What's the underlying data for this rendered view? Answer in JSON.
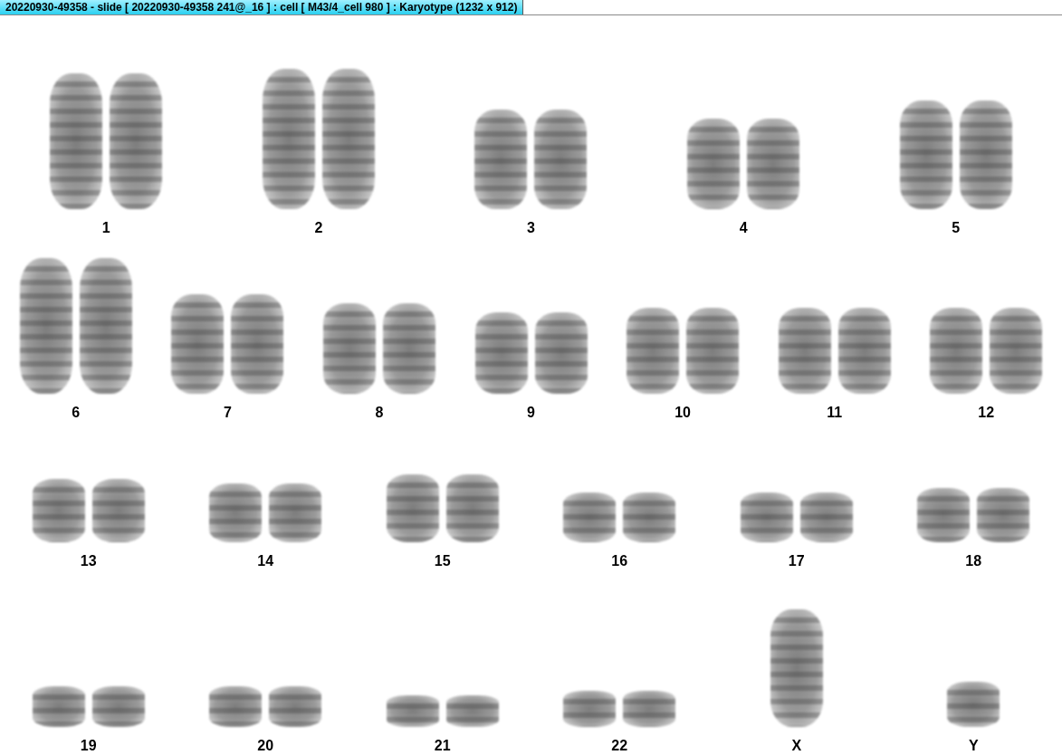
{
  "window": {
    "title": "20220930-49358 - slide [ 20220930-49358 241@_16 ] : cell [ M43/4_cell 980 ] : Karyotype  (1232 x 912)"
  },
  "rows": [
    {
      "groups": [
        {
          "label": "1",
          "kind": "pair"
        },
        {
          "label": "2",
          "kind": "pair"
        },
        {
          "label": "3",
          "kind": "pair"
        },
        {
          "label": "4",
          "kind": "pair"
        },
        {
          "label": "5",
          "kind": "pair"
        }
      ]
    },
    {
      "groups": [
        {
          "label": "6",
          "kind": "pair"
        },
        {
          "label": "7",
          "kind": "pair"
        },
        {
          "label": "8",
          "kind": "pair"
        },
        {
          "label": "9",
          "kind": "pair"
        },
        {
          "label": "10",
          "kind": "pair"
        },
        {
          "label": "11",
          "kind": "pair"
        },
        {
          "label": "12",
          "kind": "pair"
        }
      ]
    },
    {
      "groups": [
        {
          "label": "13",
          "kind": "pair"
        },
        {
          "label": "14",
          "kind": "pair"
        },
        {
          "label": "15",
          "kind": "pair"
        },
        {
          "label": "16",
          "kind": "pair"
        },
        {
          "label": "17",
          "kind": "pair"
        },
        {
          "label": "18",
          "kind": "pair"
        }
      ]
    },
    {
      "groups": [
        {
          "label": "19",
          "kind": "pair"
        },
        {
          "label": "20",
          "kind": "pair"
        },
        {
          "label": "21",
          "kind": "pair"
        },
        {
          "label": "22",
          "kind": "pair"
        },
        {
          "label": "X",
          "kind": "single"
        },
        {
          "label": "Y",
          "kind": "single"
        }
      ]
    }
  ]
}
